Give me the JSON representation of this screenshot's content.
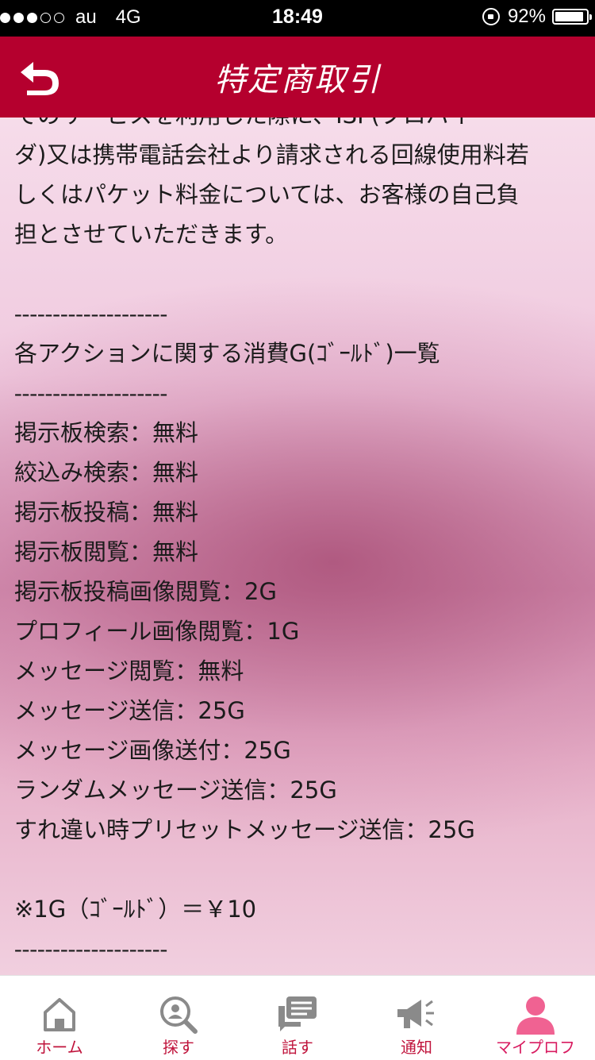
{
  "status_bar": {
    "carrier": "au",
    "network": "4G",
    "time": "18:49",
    "battery": "92%",
    "battery_level": 0.92,
    "signal_bars_filled": 3,
    "signal_bars_total": 5
  },
  "header": {
    "title": "特定商取引",
    "back_icon": "back-arrow-icon",
    "background_color": "#b5002e"
  },
  "content": {
    "lines": [
      "でのサービスを利用した際に、ISP(プロバイ",
      "ダ)又は携帯電話会社より請求される回線使用料若",
      "しくはパケット料金については、お客様の自己負",
      "担とさせていただきます。",
      "",
      "--------------------",
      "各アクションに関する消費G(ｺﾞｰﾙﾄﾞ)一覧",
      "--------------------",
      "掲示板検索：無料",
      "絞込み検索：無料",
      "掲示板投稿：無料",
      "掲示板閲覧：無料",
      "掲示板投稿画像閲覧：2G",
      "プロフィール画像閲覧：1G",
      "メッセージ閲覧：無料",
      "メッセージ送信：25G",
      "メッセージ画像送付：25G",
      "ランダムメッセージ送信：25G",
      "すれ違い時プリセットメッセージ送信：25G",
      "",
      "※1G（ｺﾞｰﾙﾄﾞ）＝￥10",
      "--------------------"
    ]
  },
  "tabbar": {
    "accent_color": "#c0143c",
    "active_color": "#f06292",
    "tabs": [
      {
        "label": "ホーム",
        "icon": "home-icon"
      },
      {
        "label": "探す",
        "icon": "search-user-icon"
      },
      {
        "label": "話す",
        "icon": "chat-icon"
      },
      {
        "label": "通知",
        "icon": "megaphone-icon"
      },
      {
        "label": "マイプロフ",
        "icon": "profile-icon",
        "active": true
      }
    ]
  }
}
